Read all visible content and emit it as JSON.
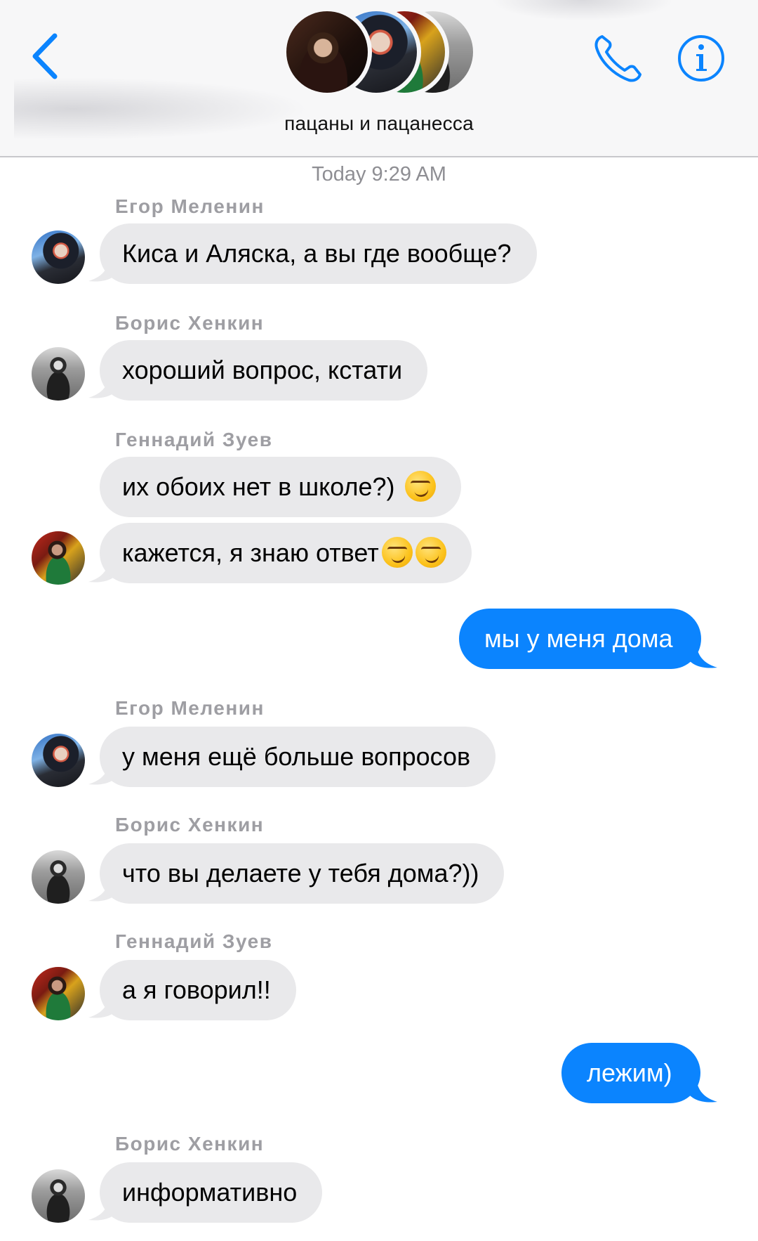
{
  "header": {
    "group_name": "пацаны и пацанесса",
    "back_icon": "chevron-left-icon",
    "call_icon": "phone-icon",
    "info_icon": "info-icon",
    "accent_color": "#0b84fe"
  },
  "timestamp": "Today 9:29 AM",
  "messages": [
    {
      "sender": "Егор Меленин",
      "text": "Киса и Аляска, а вы где вообще?"
    },
    {
      "sender": "Борис Хенкин",
      "text": "хороший вопрос, кстати"
    },
    {
      "sender": "Геннадий Зуев",
      "text": "их обоих нет в школе?)"
    },
    {
      "sender": "Геннадий Зуев",
      "text": "кажется, я знаю ответ"
    },
    {
      "sender": "me",
      "text": "мы у меня дома"
    },
    {
      "sender": "Егор Меленин",
      "text": "у меня ещё больше вопросов"
    },
    {
      "sender": "Борис Хенкин",
      "text": "что вы делаете у тебя дома?))"
    },
    {
      "sender": "Геннадий Зуев",
      "text": "а я говорил!!"
    },
    {
      "sender": "me",
      "text": "лежим)"
    },
    {
      "sender": "Борис Хенкин",
      "text": "информативно"
    }
  ],
  "emoji": "smirking-face"
}
